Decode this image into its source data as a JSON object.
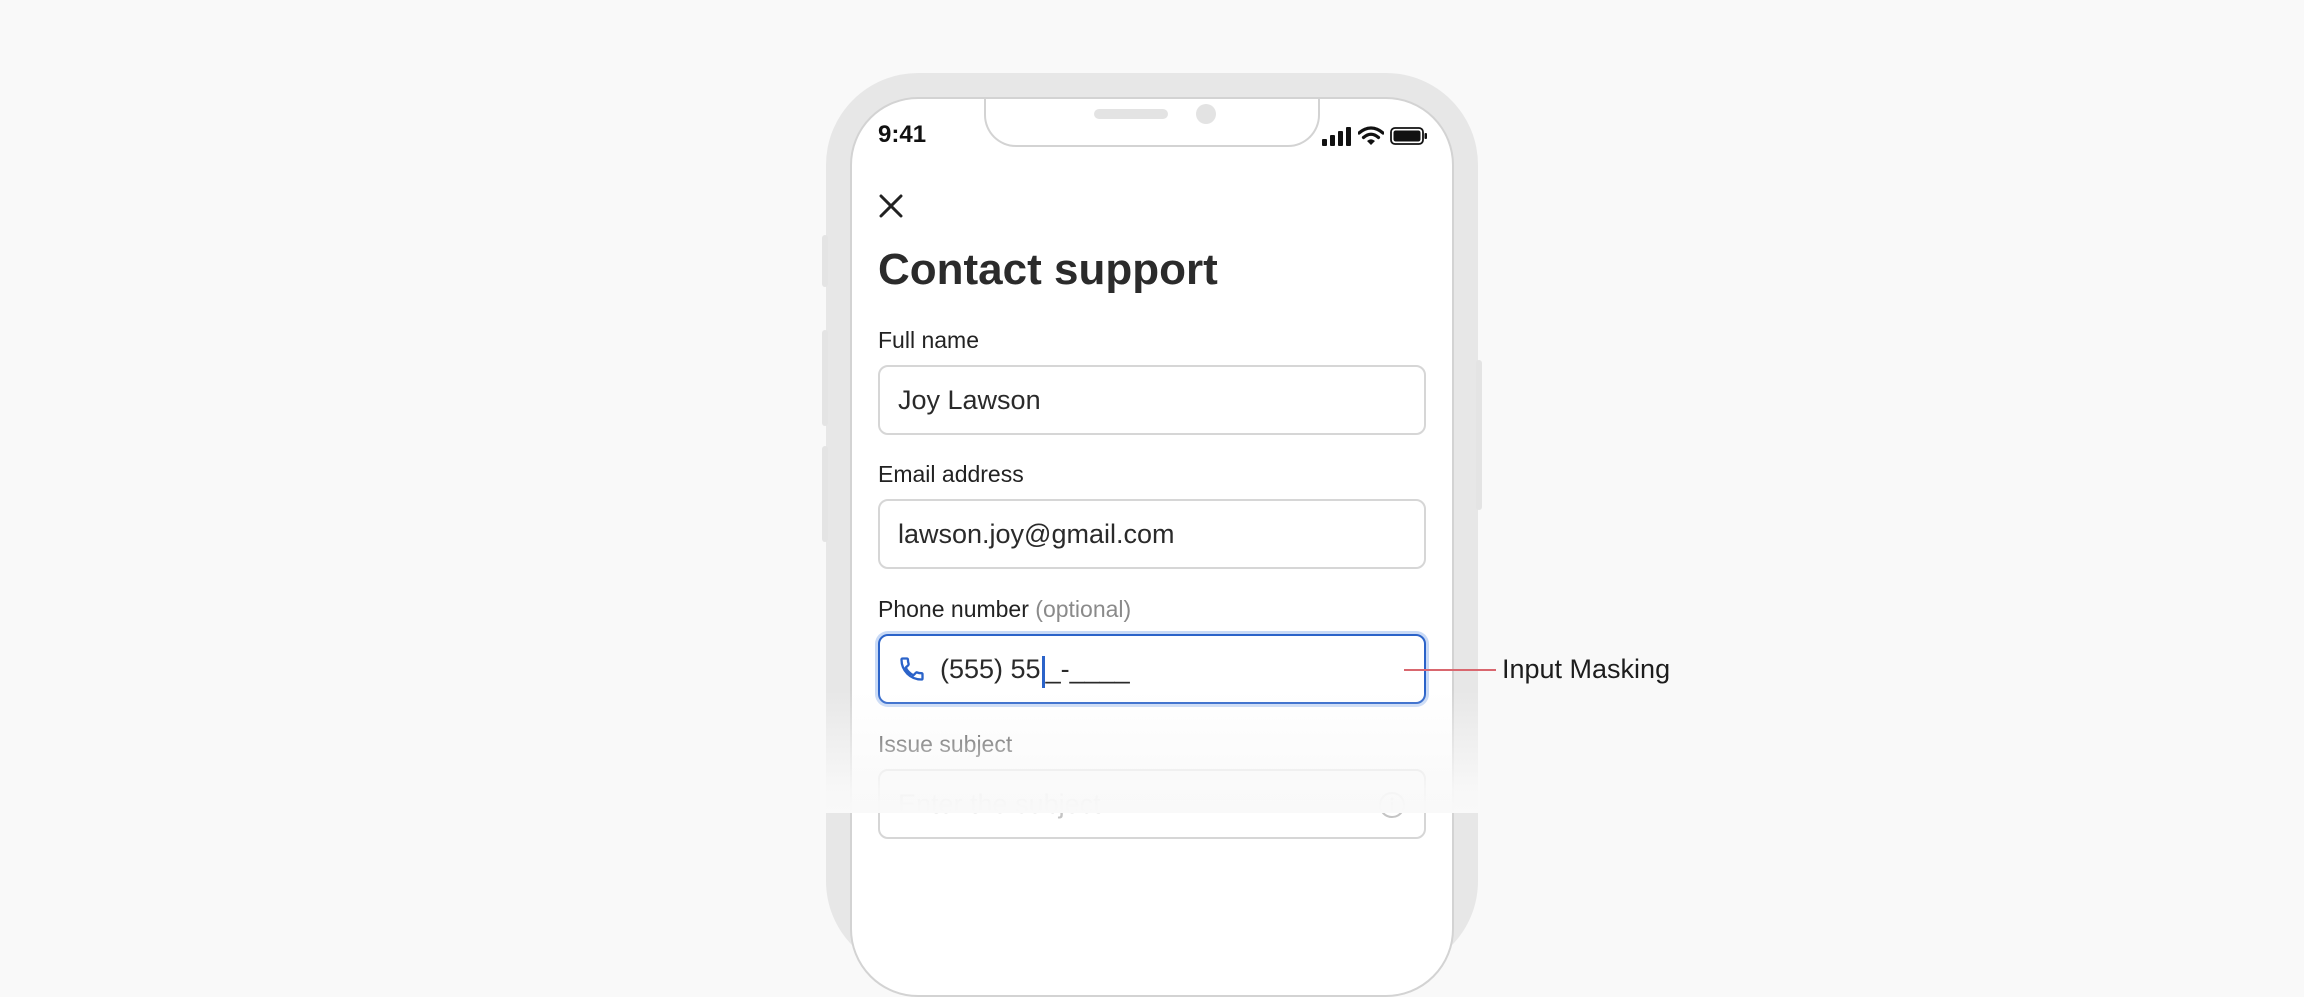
{
  "status_bar": {
    "time": "9:41"
  },
  "icons": {
    "close": "close-icon",
    "phone": "phone-icon",
    "signal": "cellular-signal-icon",
    "wifi": "wifi-icon",
    "battery": "battery-icon",
    "info": "info-icon"
  },
  "form": {
    "title": "Contact support",
    "full_name": {
      "label": "Full name",
      "value": "Joy Lawson"
    },
    "email": {
      "label": "Email address",
      "value": "lawson.joy@gmail.com"
    },
    "phone": {
      "label": "Phone number",
      "optional": "(optional)",
      "value_typed": "(555) 55",
      "value_mask": "_-____"
    },
    "subject": {
      "label": "Issue subject",
      "placeholder": "Enter the subject"
    }
  },
  "annotation": {
    "label": "Input Masking"
  },
  "colors": {
    "background": "#f9f9f9",
    "focus_blue": "#2b63c9",
    "annotation_red": "#d9676f",
    "frame_gray": "#e7e7e7"
  }
}
